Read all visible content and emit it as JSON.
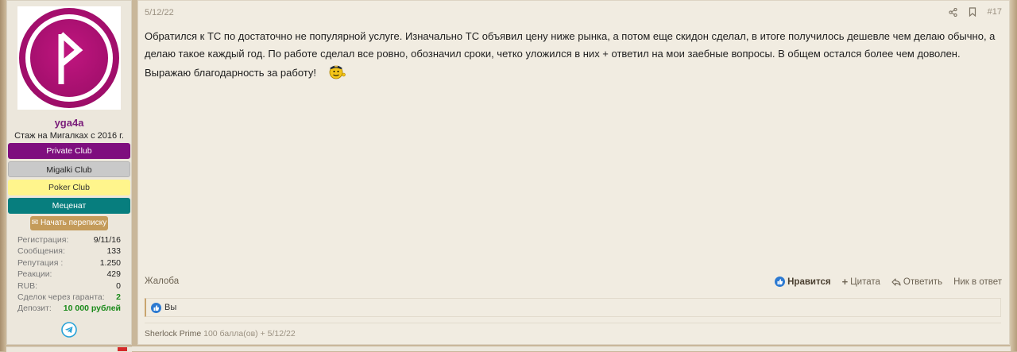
{
  "user": {
    "name": "yga4a",
    "title": "Стаж на Мигалках с 2016 г.",
    "avatar_letter": "rune",
    "banners": [
      "Private Club",
      "Migalki Club",
      "Poker Club",
      "Меценат"
    ],
    "message_button": "Начать переписку",
    "stats": [
      {
        "label": "Регистрация:",
        "value": "9/11/16"
      },
      {
        "label": "Сообщения:",
        "value": "133"
      },
      {
        "label": "Репутация :",
        "value": "1.250"
      },
      {
        "label": "Реакции:",
        "value": "429"
      },
      {
        "label": "RUB:",
        "value": "0"
      },
      {
        "label": "Сделок через гаранта:",
        "value": "2"
      },
      {
        "label": "Депозит:",
        "value": "10 000 рублей"
      }
    ],
    "social_icon": "telegram-icon"
  },
  "post": {
    "date": "5/12/22",
    "number": "#17",
    "text": "Обратился к ТС по достаточно не популярной услуге. Изначально ТС объявил цену ниже рынка, а потом еще скидон сделал, в итоге получилось дешевле чем делаю обычно, а делаю такое каждый год. По работе сделал все ровно, обозначил сроки, четко уложился в них + ответил на мои заебные вопросы. В общем остался более чем доволен. Выражаю благодарность за работу!",
    "complaint": "Жалоба",
    "actions": {
      "like": "Нравится",
      "quote": "Цитата",
      "reply": "Ответить",
      "nick": "Ник в ответ"
    },
    "reactions_text": "Вы",
    "points_user": "Sherlock Prime",
    "points_text": "100 балла(ов) + 5/12/22"
  },
  "colors": {
    "accent": "#c49b5a",
    "username": "#7a1d7a",
    "private_club": "#7e0e7e",
    "mecenat": "#077e7e",
    "poker": "#fff58c"
  }
}
